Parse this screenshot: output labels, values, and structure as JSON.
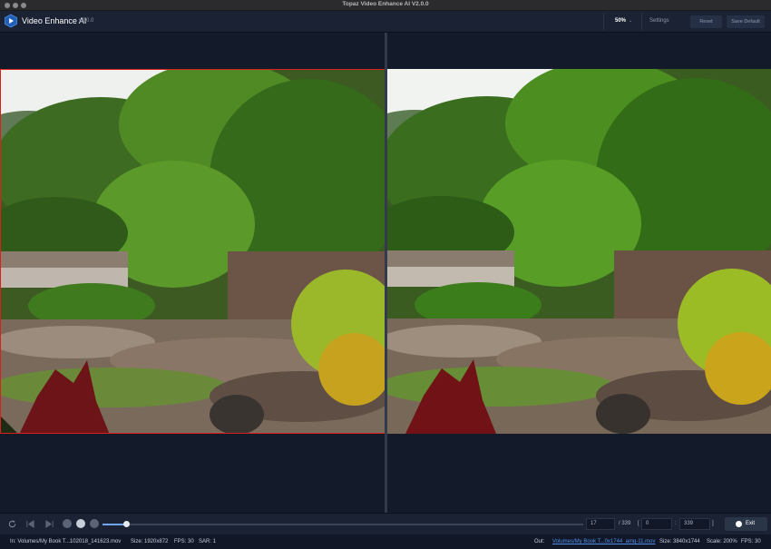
{
  "window": {
    "title": "Topaz Video Enhance AI V2.0.0"
  },
  "header": {
    "app_name": "Video Enhance AI",
    "version": "v2.0.0",
    "zoom": "50%",
    "settings_label": "Settings",
    "reset_label": "Reset",
    "save_default_label": "Save Default"
  },
  "preview": {
    "left_label": "original-preview",
    "right_label": "enhanced-preview",
    "highlight_color": "#d8201c"
  },
  "playback": {
    "progress": 0.05,
    "current_frame": "17",
    "total_frames": "/ 339",
    "range_open": "[",
    "range_start": "0",
    "range_sep": ":",
    "range_end": "339",
    "range_close": "]",
    "exit_label": "Exit",
    "accent_color": "#6fa8f0"
  },
  "status": {
    "input_path": "In: Volumes/My Book T...102018_141623.mov",
    "input_size": "Size: 1920x872",
    "input_fps": "FPS: 30",
    "input_sar": "SAR: 1",
    "out_label": "Out:",
    "output_path": "Volumes/My Book T...0x1744_amq-11.mov",
    "output_size": "Size: 3840x1744",
    "output_scale": "Scale: 200%",
    "output_fps": "FPS: 30"
  }
}
